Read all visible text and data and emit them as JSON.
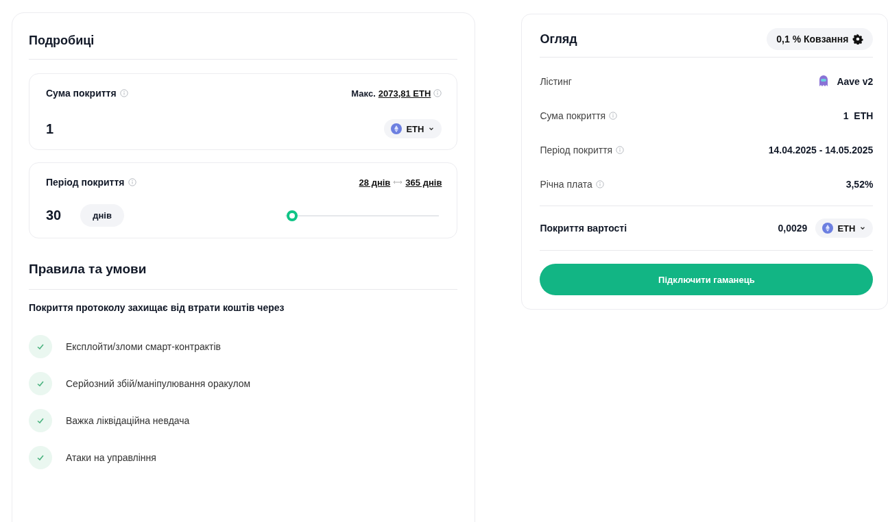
{
  "details": {
    "title": "Подробиці",
    "amount": {
      "label": "Сума покриття",
      "max_label": "Макс.",
      "max_value": "2073,81 ETH",
      "value": "1",
      "token": "ETH"
    },
    "period": {
      "label": "Період покриття",
      "min": "28 днів",
      "max": "365 днів",
      "value": "30",
      "unit": "днів",
      "level": 0.01
    }
  },
  "rules": {
    "title": "Правила та умови",
    "intro": "Покриття протоколу захищає від втрати коштів через",
    "items": [
      {
        "text": "Експлойти/зломи смарт-контрактів",
        "checked": true
      },
      {
        "text": "Серйозний збій/маніпулювання оракулом",
        "checked": true
      },
      {
        "text": "Важка ліквідаційна невдача",
        "checked": true
      },
      {
        "text": "Атаки на управління",
        "checked": true
      }
    ]
  },
  "overview": {
    "title": "Огляд",
    "slippage": "0,1 % Ковзання",
    "rows": [
      {
        "kind": "listing",
        "label": "Лістинг",
        "value": "Aave v2"
      },
      {
        "kind": "info",
        "label": "Сума покриття",
        "value": "1  ETH"
      },
      {
        "kind": "info",
        "label": "Період покриття",
        "value": "14.04.2025 - 14.05.2025"
      },
      {
        "kind": "info",
        "label": "Річна плата",
        "value": "3,52%"
      }
    ],
    "cost": {
      "label": "Покриття вартості",
      "value": "0,0029",
      "token": "ETH"
    },
    "button": "Підключити гаманець"
  }
}
